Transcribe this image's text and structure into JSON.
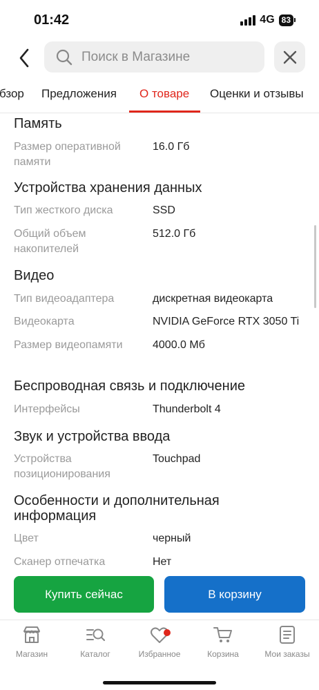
{
  "status": {
    "time": "01:42",
    "network": "4G",
    "battery": "83"
  },
  "search": {
    "placeholder": "Поиск в Магазине"
  },
  "tabs": [
    {
      "label": "Обзор",
      "visible_text": "бзор"
    },
    {
      "label": "Предложения"
    },
    {
      "label": "О товаре",
      "active": true
    },
    {
      "label": "Оценки и отзывы"
    }
  ],
  "specs": {
    "memory": {
      "title": "Память",
      "rows": [
        {
          "label": "Размер оперативной памяти",
          "value": "16.0 Гб"
        }
      ]
    },
    "storage": {
      "title": "Устройства хранения данных",
      "rows": [
        {
          "label": "Тип жесткого диска",
          "value": "SSD"
        },
        {
          "label": "Общий объем накопителей",
          "value": "512.0 Гб"
        }
      ]
    },
    "video": {
      "title": "Видео",
      "rows": [
        {
          "label": "Тип видеоадаптера",
          "value": "дискретная видеокарта"
        },
        {
          "label": "Видеокарта",
          "value": "NVIDIA GeForce RTX 3050 Ti"
        },
        {
          "label": "Размер видеопамяти",
          "value": "4000.0 Мб"
        }
      ]
    },
    "wireless": {
      "title": "Беспроводная связь и подключение",
      "rows": [
        {
          "label": "Интерфейсы",
          "value": "Thunderbolt 4"
        }
      ]
    },
    "input": {
      "title": "Звук и устройства ввода",
      "rows": [
        {
          "label": "Устройства позиционирования",
          "value": "Touchpad"
        }
      ]
    },
    "extra": {
      "title": "Особенности и дополнительная информация",
      "rows": [
        {
          "label": "Цвет",
          "value": "черный"
        },
        {
          "label": "Сканер отпечатка",
          "value": "Нет"
        }
      ]
    }
  },
  "actions": {
    "buy_now": "Купить сейчас",
    "add_to_cart": "В корзину"
  },
  "nav": [
    {
      "label": "Магазин",
      "icon": "store-icon"
    },
    {
      "label": "Каталог",
      "icon": "catalog-search-icon"
    },
    {
      "label": "Избранное",
      "icon": "heart-icon",
      "badge": true
    },
    {
      "label": "Корзина",
      "icon": "cart-icon"
    },
    {
      "label": "Мои заказы",
      "icon": "orders-icon"
    }
  ],
  "colors": {
    "accent": "#e0261b",
    "buy": "#16a441",
    "cart": "#1570c9",
    "label_gray": "#9a9a9a"
  }
}
